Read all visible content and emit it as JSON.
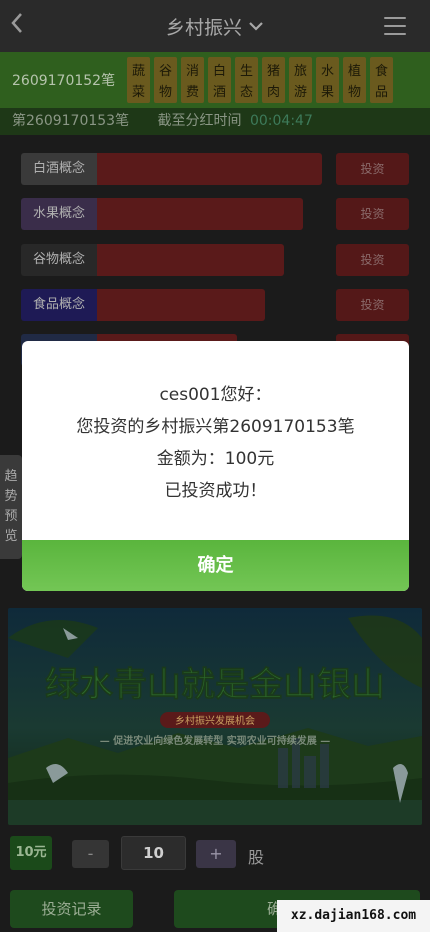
{
  "header": {
    "title": "乡村振兴",
    "back_icon": "chevron-left-icon",
    "dropdown_icon": "chevron-down-icon",
    "menu_icon": "hamburger-icon"
  },
  "period": {
    "number": "2609170152笔",
    "categories": [
      [
        "蔬",
        "菜"
      ],
      [
        "谷",
        "物"
      ],
      [
        "消",
        "费"
      ],
      [
        "白",
        "酒"
      ],
      [
        "生",
        "态"
      ],
      [
        "猪",
        "肉"
      ],
      [
        "旅",
        "游"
      ],
      [
        "水",
        "果"
      ],
      [
        "植",
        "物"
      ],
      [
        "食",
        "品"
      ]
    ]
  },
  "timebar": {
    "next": "第2609170153笔",
    "deadline_label": "截至分红时间",
    "countdown": "00:04:47"
  },
  "rows": [
    {
      "label": "白酒概念",
      "fill": 0.96,
      "button": "投资",
      "color": "#3a3a3a"
    },
    {
      "label": "水果概念",
      "fill": 0.88,
      "button": "投资",
      "color": "#3a2d4a"
    },
    {
      "label": "谷物概念",
      "fill": 0.8,
      "button": "投资",
      "color": "#282828"
    },
    {
      "label": "食品概念",
      "fill": 0.72,
      "button": "投资",
      "color": "#1e1a55"
    },
    {
      "label": "",
      "fill": 0.6,
      "button": "",
      "color": "#202a45"
    }
  ],
  "sidetab": {
    "chars": [
      "趋",
      "势",
      "预",
      "览"
    ]
  },
  "banner": {
    "headline": "绿水青山就是金山银山",
    "subhead": "乡村振兴发展机会",
    "tagline": "— 促进农业向绿色发展转型 实现农业可持续发展 —"
  },
  "bottom": {
    "amount_badge": "10元",
    "minus": "-",
    "quantity": "10",
    "plus": "+",
    "unit": "股",
    "record_button": "投资记录",
    "confirm_button": "确认投资"
  },
  "modal": {
    "line1": "ces001您好：",
    "line2": "您投资的乡村振兴第2609170153笔",
    "line3": "金额为：100元",
    "line4": "已投资成功！",
    "ok": "确定"
  },
  "watermark": "xz.dajian168.com"
}
